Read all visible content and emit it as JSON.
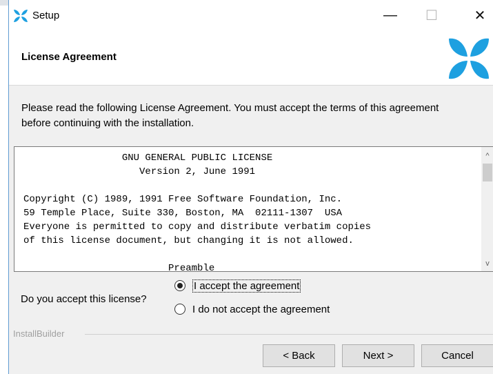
{
  "window": {
    "title": "Setup",
    "minimize_glyph": "—",
    "maximize_glyph": "☐",
    "close_glyph": "✕"
  },
  "header": {
    "title": "License Agreement",
    "logo_icon": "installbuilder-logo-icon",
    "logo_color": "#1ea0e0"
  },
  "intro_text": "Please read the following License Agreement. You must accept the terms of this agreement before continuing with the installation.",
  "license_text": "                 GNU GENERAL PUBLIC LICENSE\n                    Version 2, June 1991\n\nCopyright (C) 1989, 1991 Free Software Foundation, Inc.\n59 Temple Place, Suite 330, Boston, MA  02111-1307  USA\nEveryone is permitted to copy and distribute verbatim copies\nof this license document, but changing it is not allowed.\n\n                         Preamble",
  "scrollbar": {
    "up_glyph": "^",
    "down_glyph": "v"
  },
  "acceptance": {
    "question": "Do you accept this license?",
    "options": [
      {
        "label": "I accept the agreement",
        "selected": true
      },
      {
        "label": "I do not accept the agreement",
        "selected": false
      }
    ]
  },
  "branding": "InstallBuilder",
  "buttons": {
    "back": "< Back",
    "next": "Next >",
    "cancel": "Cancel"
  }
}
